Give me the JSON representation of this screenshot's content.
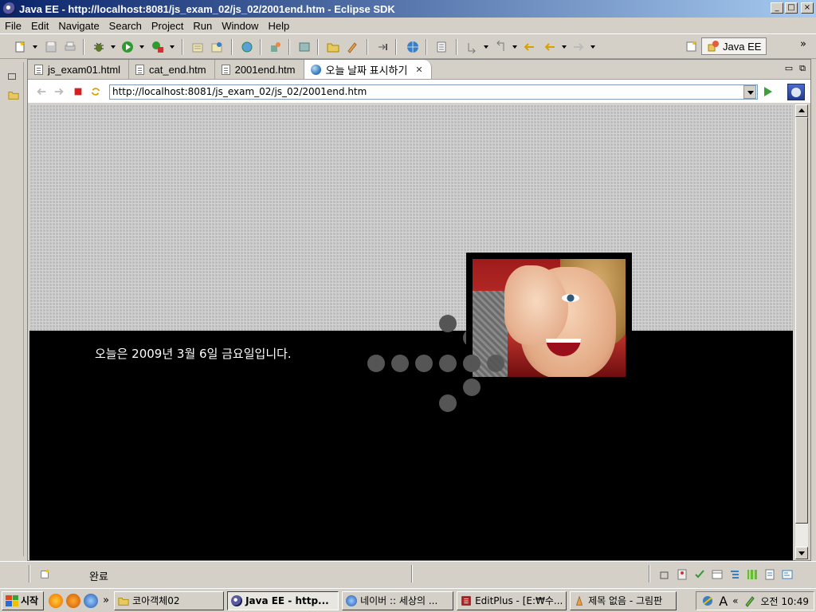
{
  "window": {
    "title": "Java EE - http://localhost:8081/js_exam_02/js_02/2001end.htm - Eclipse SDK",
    "controls": {
      "minimize": "_",
      "maximize": "□",
      "close": "×"
    }
  },
  "menubar": {
    "items": [
      "File",
      "Edit",
      "Navigate",
      "Search",
      "Project",
      "Run",
      "Window",
      "Help"
    ]
  },
  "toolbar": {
    "perspective_label": "Java EE",
    "overflow": "»"
  },
  "editor": {
    "tabs": [
      {
        "label": "js_exam01.html",
        "icon": "html-file-icon"
      },
      {
        "label": "cat_end.htm",
        "icon": "html-file-icon"
      },
      {
        "label": "2001end.htm",
        "icon": "html-file-icon"
      },
      {
        "label": "오늘 날짜 표시하기",
        "icon": "globe-icon",
        "active": true,
        "close": "✕"
      }
    ],
    "url": "http://localhost:8081/js_exam_02/js_02/2001end.htm"
  },
  "page": {
    "date_message": "오늘은 2009년 3월 6일 금요일입니다.",
    "colors": {
      "background": "#000000",
      "grid": "#bdbdbd",
      "dots": "#555555",
      "text": "#ffffff"
    }
  },
  "status": {
    "text": "완료"
  },
  "taskbar": {
    "start_label": "시작",
    "overflow": "»",
    "tasks": [
      {
        "label": "코아객체02",
        "icon": "folder-icon"
      },
      {
        "label": "Java EE - http...",
        "icon": "eclipse-icon",
        "active": true
      },
      {
        "label": "네이버 :: 세상의 ...",
        "icon": "ie-icon"
      },
      {
        "label": "EditPlus - [E:₩수...",
        "icon": "editplus-icon"
      },
      {
        "label": "제목 없음 - 그림판",
        "icon": "paint-icon"
      }
    ],
    "tray": {
      "collapse": "«",
      "time": "오전 10:49"
    }
  }
}
